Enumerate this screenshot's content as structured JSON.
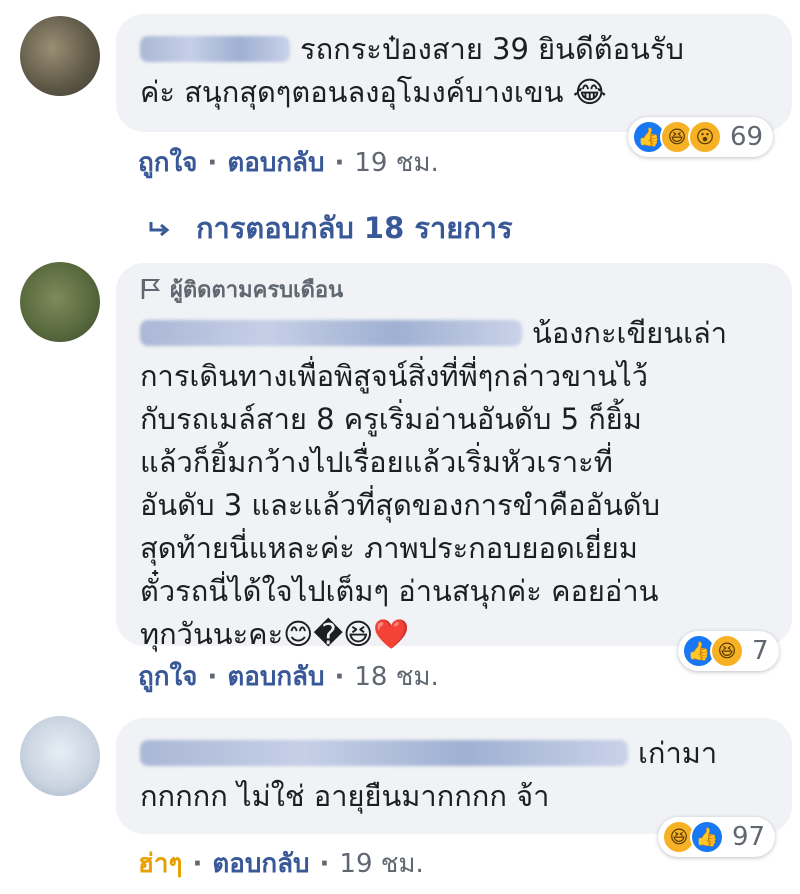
{
  "comments": [
    {
      "author": "Mut Lin",
      "text_lines": [
        "รถกระป๋องสาย 39 ยินดีต้อนรับ",
        "ค่ะ สนุกสุดๆตอนลงอุโมงค์บางเขน 😂"
      ],
      "reactions": {
        "icons": [
          "like",
          "haha",
          "wow"
        ],
        "count": "69"
      },
      "actions": {
        "primary": "ถูกใจ",
        "reply": "ตอบกลับ",
        "time": "19 ชม."
      }
    },
    {
      "badge": "ผู้ติดตามครบเดือน",
      "author": "Nawarat Tadakittisarn",
      "text_lines": [
        "น้องกะเขียนเล่า",
        "การเดินทางเพื่อพิสูจน์สิ่งที่พี่ๆกล่าวขานไว้",
        "กับรถเมล์สาย 8 ครูเริ่มอ่านอันดับ 5 ก็ยิ้ม",
        "แล้วก็ยิ้มกว้างไปเรื่อยแล้วเริ่มหัวเราะที่",
        "อันดับ 3 และแล้วที่สุดของการขำคืออันดับ",
        "สุดท้ายนี่แหละค่ะ ภาพประกอบยอดเยี่ยม",
        "ตั๋วรถนี่ได้ใจไปเต็มๆ อ่านสนุกค่ะ คอยอ่าน",
        "ทุกวันนะคะ😊�😆❤️"
      ],
      "reactions": {
        "icons": [
          "like",
          "haha"
        ],
        "count": "7"
      },
      "actions": {
        "primary": "ถูกใจ",
        "reply": "ตอบกลับ",
        "time": "18 ชม."
      }
    },
    {
      "author": "Sarayut Amirius Boonsaeng",
      "text_lines": [
        "เก่ามา",
        "กกกกก ไม่ใช่ อายุยืนมากกกก จ้า"
      ],
      "reactions": {
        "icons": [
          "haha",
          "like"
        ],
        "count": "97"
      },
      "actions": {
        "primary": "ฮ่าๆ",
        "reply": "ตอบกลับ",
        "time": "19 ชม."
      }
    }
  ],
  "replies_link": "การตอบกลับ 18 รายการ",
  "icons": {
    "like": "like-icon",
    "haha": "haha-icon",
    "wow": "wow-icon",
    "reply_arrow": "reply-arrow-icon",
    "flag": "flag-icon"
  },
  "colors": {
    "link": "#385898",
    "bubble": "#f0f2f5",
    "like": "#1877f2",
    "haha_text": "#e6a100"
  }
}
